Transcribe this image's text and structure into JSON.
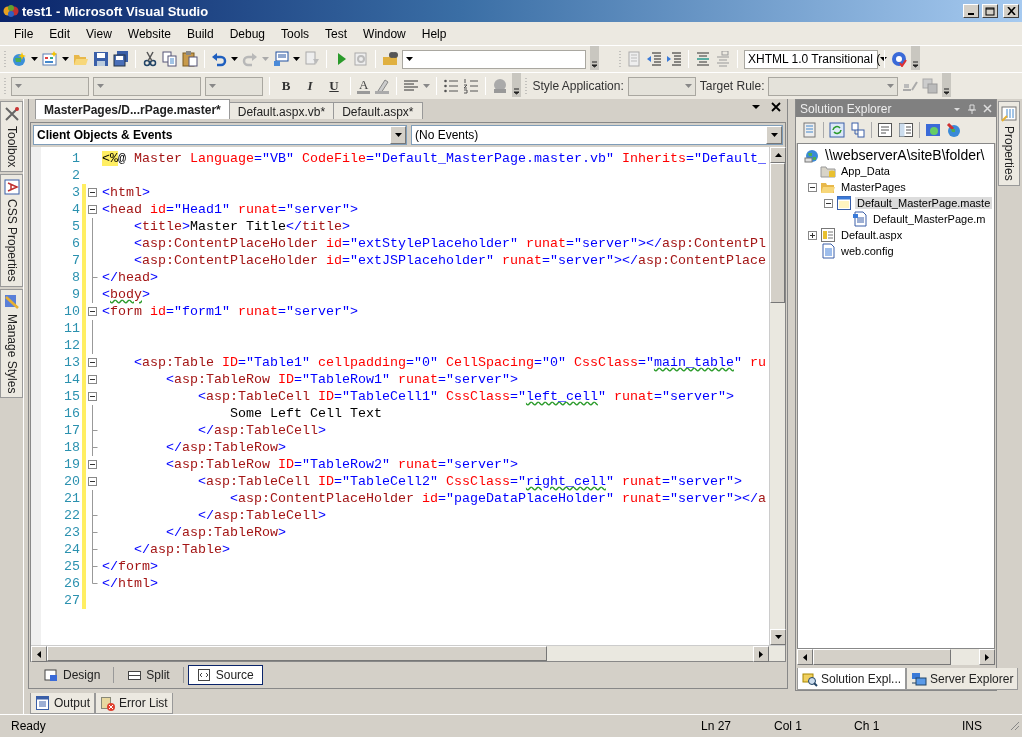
{
  "window": {
    "title": "test1 - Microsoft Visual Studio"
  },
  "menu": [
    "File",
    "Edit",
    "View",
    "Website",
    "Build",
    "Debug",
    "Tools",
    "Test",
    "Window",
    "Help"
  ],
  "toolbar_standard": {
    "doctype_combo": "XHTML 1.0 Transitional ("
  },
  "toolbar_formatting": {
    "format_buttons": [
      "B",
      "I",
      "U"
    ],
    "font_color": "A",
    "style_application_label": "Style Application:",
    "target_rule_label": "Target Rule:"
  },
  "left_dock_tabs": [
    {
      "label": "Toolbox",
      "kind": "toolbox"
    },
    {
      "label": "CSS Properties",
      "kind": "css"
    },
    {
      "label": "Manage Styles",
      "kind": "styles"
    }
  ],
  "document_tabs": [
    {
      "label": "MasterPages/D...rPage.master*",
      "selected": true
    },
    {
      "label": "Default.aspx.vb*",
      "selected": false
    },
    {
      "label": "Default.aspx*",
      "selected": false
    }
  ],
  "editor": {
    "object_dropdown": "Client Objects & Events",
    "event_dropdown": "(No Events)",
    "lines": [
      {
        "number": "1",
        "kind": "plain",
        "changed": false,
        "tokens": [
          {
            "kind": "mark",
            "text": "<%"
          },
          {
            "kind": "text",
            "text": "@ "
          },
          {
            "kind": "tag",
            "text": "Master"
          },
          {
            "kind": "attr",
            "text": " Language"
          },
          {
            "kind": "value",
            "text": "=\"VB\""
          },
          {
            "kind": "attr",
            "text": " CodeFile"
          },
          {
            "kind": "value",
            "text": "=\"Default_MasterPage.master.vb\""
          },
          {
            "kind": "attr",
            "text": " Inherits"
          },
          {
            "kind": "value",
            "text": "=\"Default_"
          }
        ]
      },
      {
        "number": "2",
        "kind": "plain",
        "changed": false
      },
      {
        "number": "3",
        "kind": "fold_start",
        "changed": true,
        "tokens": [
          {
            "kind": "delim",
            "text": "<"
          },
          {
            "kind": "tag",
            "text": "html"
          },
          {
            "kind": "delim",
            "text": ">"
          }
        ]
      },
      {
        "number": "4",
        "kind": "fold_start",
        "changed": true,
        "tokens": [
          {
            "kind": "delim",
            "text": "<"
          },
          {
            "kind": "tag",
            "text": "head"
          },
          {
            "kind": "attr",
            "text": " id"
          },
          {
            "kind": "value",
            "text": "=\"Head1\""
          },
          {
            "kind": "attr",
            "text": " runat"
          },
          {
            "kind": "value",
            "text": "=\"server\""
          },
          {
            "kind": "delim",
            "text": ">"
          }
        ]
      },
      {
        "number": "5",
        "kind": "fold_body",
        "changed": true,
        "tokens": [
          {
            "kind": "delim",
            "text": "    <"
          },
          {
            "kind": "tag",
            "text": "title"
          },
          {
            "kind": "delim",
            "text": ">"
          },
          {
            "kind": "text",
            "text": "Master Title"
          },
          {
            "kind": "delim",
            "text": "</"
          },
          {
            "kind": "tag",
            "text": "title"
          },
          {
            "kind": "delim",
            "text": ">"
          }
        ]
      },
      {
        "number": "6",
        "kind": "fold_body",
        "changed": true,
        "tokens": [
          {
            "kind": "delim",
            "text": "    <"
          },
          {
            "kind": "tag",
            "text": "asp:ContentPlaceHolder"
          },
          {
            "kind": "attr",
            "text": " id"
          },
          {
            "kind": "value",
            "text": "=\"extStylePlaceholder\""
          },
          {
            "kind": "attr",
            "text": " runat"
          },
          {
            "kind": "value",
            "text": "=\"server\""
          },
          {
            "kind": "delim",
            "text": "></"
          },
          {
            "kind": "tag",
            "text": "asp:ContentPl"
          }
        ]
      },
      {
        "number": "7",
        "kind": "fold_body",
        "changed": true,
        "tokens": [
          {
            "kind": "delim",
            "text": "    <"
          },
          {
            "kind": "tag",
            "text": "asp:ContentPlaceHolder"
          },
          {
            "kind": "attr",
            "text": " id"
          },
          {
            "kind": "value",
            "text": "=\"extJSPlaceholder\""
          },
          {
            "kind": "attr",
            "text": " runat"
          },
          {
            "kind": "value",
            "text": "=\"server\""
          },
          {
            "kind": "delim",
            "text": "></"
          },
          {
            "kind": "tag",
            "text": "asp:ContentPlace"
          }
        ]
      },
      {
        "number": "8",
        "kind": "fold_end",
        "changed": true,
        "tokens": [
          {
            "kind": "delim",
            "text": "</"
          },
          {
            "kind": "tag",
            "text": "head"
          },
          {
            "kind": "delim",
            "text": ">"
          }
        ]
      },
      {
        "number": "9",
        "kind": "fold_body",
        "changed": true,
        "tokens": [
          {
            "kind": "delim",
            "text": "<"
          },
          {
            "kind": "tag_wavy",
            "text": "body"
          },
          {
            "kind": "delim",
            "text": ">"
          }
        ]
      },
      {
        "number": "10",
        "kind": "fold_start",
        "changed": true,
        "tokens": [
          {
            "kind": "delim",
            "text": "<"
          },
          {
            "kind": "tag",
            "text": "form"
          },
          {
            "kind": "attr",
            "text": " id"
          },
          {
            "kind": "value",
            "text": "=\"form1\""
          },
          {
            "kind": "attr",
            "text": " runat"
          },
          {
            "kind": "value",
            "text": "=\"server\""
          },
          {
            "kind": "delim",
            "text": ">"
          }
        ]
      },
      {
        "number": "11",
        "kind": "fold_body",
        "changed": true
      },
      {
        "number": "12",
        "kind": "fold_body",
        "changed": true
      },
      {
        "number": "13",
        "kind": "fold_start",
        "changed": true,
        "tokens": [
          {
            "kind": "delim",
            "text": "    <"
          },
          {
            "kind": "tag",
            "text": "asp:Table"
          },
          {
            "kind": "attr",
            "text": " ID"
          },
          {
            "kind": "value",
            "text": "=\"Table1\""
          },
          {
            "kind": "attr",
            "text": " cellpadding"
          },
          {
            "kind": "value",
            "text": "=\"0\""
          },
          {
            "kind": "attr",
            "text": " CellSpacing"
          },
          {
            "kind": "value",
            "text": "=\"0\""
          },
          {
            "kind": "attr",
            "text": " CssClass"
          },
          {
            "kind": "value",
            "text": "=\""
          },
          {
            "kind": "value_wavy",
            "text": "main_table"
          },
          {
            "kind": "value",
            "text": "\""
          },
          {
            "kind": "attr",
            "text": " ru"
          }
        ]
      },
      {
        "number": "14",
        "kind": "fold_start",
        "changed": true,
        "tokens": [
          {
            "kind": "delim",
            "text": "        <"
          },
          {
            "kind": "tag",
            "text": "asp:TableRow"
          },
          {
            "kind": "attr",
            "text": " ID"
          },
          {
            "kind": "value",
            "text": "=\"TableRow1\""
          },
          {
            "kind": "attr",
            "text": " runat"
          },
          {
            "kind": "value",
            "text": "=\"server\""
          },
          {
            "kind": "delim",
            "text": ">"
          }
        ]
      },
      {
        "number": "15",
        "kind": "fold_start",
        "changed": true,
        "tokens": [
          {
            "kind": "delim",
            "text": "            <"
          },
          {
            "kind": "tag",
            "text": "asp:TableCell"
          },
          {
            "kind": "attr",
            "text": " ID"
          },
          {
            "kind": "value",
            "text": "=\"TableCell1\""
          },
          {
            "kind": "attr",
            "text": " CssClass"
          },
          {
            "kind": "value",
            "text": "=\""
          },
          {
            "kind": "value_wavy",
            "text": "left_cell"
          },
          {
            "kind": "value",
            "text": "\""
          },
          {
            "kind": "attr",
            "text": " runat"
          },
          {
            "kind": "value",
            "text": "=\"server\""
          },
          {
            "kind": "delim",
            "text": ">"
          }
        ]
      },
      {
        "number": "16",
        "kind": "fold_body",
        "changed": true,
        "tokens": [
          {
            "kind": "text",
            "text": "                Some Left Cell Text"
          }
        ]
      },
      {
        "number": "17",
        "kind": "fold_end",
        "changed": true,
        "tokens": [
          {
            "kind": "delim",
            "text": "            </"
          },
          {
            "kind": "tag",
            "text": "asp:TableCell"
          },
          {
            "kind": "delim",
            "text": ">"
          }
        ]
      },
      {
        "number": "18",
        "kind": "fold_end",
        "changed": true,
        "tokens": [
          {
            "kind": "delim",
            "text": "        </"
          },
          {
            "kind": "tag",
            "text": "asp:TableRow"
          },
          {
            "kind": "delim",
            "text": ">"
          }
        ]
      },
      {
        "number": "19",
        "kind": "fold_start",
        "changed": true,
        "tokens": [
          {
            "kind": "delim",
            "text": "        <"
          },
          {
            "kind": "tag",
            "text": "asp:TableRow"
          },
          {
            "kind": "attr",
            "text": " ID"
          },
          {
            "kind": "value",
            "text": "=\"TableRow2\""
          },
          {
            "kind": "attr",
            "text": " runat"
          },
          {
            "kind": "value",
            "text": "=\"server\""
          },
          {
            "kind": "delim",
            "text": ">"
          }
        ]
      },
      {
        "number": "20",
        "kind": "fold_start",
        "changed": true,
        "tokens": [
          {
            "kind": "delim",
            "text": "            <"
          },
          {
            "kind": "tag",
            "text": "asp:TableCell"
          },
          {
            "kind": "attr",
            "text": " ID"
          },
          {
            "kind": "value",
            "text": "=\"TableCell2\""
          },
          {
            "kind": "attr",
            "text": " CssClass"
          },
          {
            "kind": "value",
            "text": "=\""
          },
          {
            "kind": "value_wavy",
            "text": "right_cell"
          },
          {
            "kind": "value",
            "text": "\""
          },
          {
            "kind": "attr",
            "text": " runat"
          },
          {
            "kind": "value",
            "text": "=\"server\""
          },
          {
            "kind": "delim",
            "text": ">"
          }
        ]
      },
      {
        "number": "21",
        "kind": "fold_body",
        "changed": true,
        "tokens": [
          {
            "kind": "delim",
            "text": "                <"
          },
          {
            "kind": "tag",
            "text": "asp:ContentPlaceHolder"
          },
          {
            "kind": "attr",
            "text": " id"
          },
          {
            "kind": "value",
            "text": "=\"pageDataPlaceHolder\""
          },
          {
            "kind": "attr",
            "text": " runat"
          },
          {
            "kind": "value",
            "text": "=\"server\""
          },
          {
            "kind": "delim",
            "text": "></"
          },
          {
            "kind": "tag",
            "text": "a"
          }
        ]
      },
      {
        "number": "22",
        "kind": "fold_end",
        "changed": true,
        "tokens": [
          {
            "kind": "delim",
            "text": "            </"
          },
          {
            "kind": "tag",
            "text": "asp:TableCell"
          },
          {
            "kind": "delim",
            "text": ">"
          }
        ]
      },
      {
        "number": "23",
        "kind": "fold_end",
        "changed": true,
        "tokens": [
          {
            "kind": "delim",
            "text": "        </"
          },
          {
            "kind": "tag",
            "text": "asp:TableRow"
          },
          {
            "kind": "delim",
            "text": ">"
          }
        ]
      },
      {
        "number": "24",
        "kind": "fold_end",
        "changed": true,
        "tokens": [
          {
            "kind": "delim",
            "text": "    </"
          },
          {
            "kind": "tag",
            "text": "asp:Table"
          },
          {
            "kind": "delim",
            "text": ">"
          }
        ]
      },
      {
        "number": "25",
        "kind": "fold_end",
        "changed": true,
        "tokens": [
          {
            "kind": "delim",
            "text": "</"
          },
          {
            "kind": "tag",
            "text": "form"
          },
          {
            "kind": "delim",
            "text": ">"
          }
        ]
      },
      {
        "number": "26",
        "kind": "fold_last",
        "changed": true,
        "tokens": [
          {
            "kind": "delim",
            "text": "</"
          },
          {
            "kind": "tag",
            "text": "html"
          },
          {
            "kind": "delim",
            "text": ">"
          }
        ]
      },
      {
        "number": "27",
        "kind": "plain",
        "changed": true
      }
    ]
  },
  "view_tabs": [
    {
      "label": "Design",
      "kind": "design",
      "selected": false
    },
    {
      "label": "Split",
      "kind": "split",
      "selected": false
    },
    {
      "label": "Source",
      "kind": "source",
      "selected": true
    }
  ],
  "bottom_tabs": [
    {
      "label": "Output",
      "kind": "output"
    },
    {
      "label": "Error List",
      "kind": "errors"
    }
  ],
  "solution_explorer": {
    "title": "Solution Explorer",
    "tree": [
      {
        "label": "\\\\webserverA\\siteB\\folder\\",
        "kind": "web",
        "selected": false,
        "children": [
          {
            "label": "App_Data",
            "kind": "data_folder",
            "selected": false
          },
          {
            "label": "MasterPages",
            "kind": "folder",
            "selected": false,
            "expanded": true,
            "children": [
              {
                "label": "Default_MasterPage.maste",
                "kind": "master",
                "selected": true,
                "expanded": true,
                "children": [
                  {
                    "label": "Default_MasterPage.m",
                    "kind": "code",
                    "selected": false
                  }
                ]
              }
            ]
          },
          {
            "label": "Default.aspx",
            "kind": "page",
            "selected": false,
            "expanded": false
          },
          {
            "label": "web.config",
            "kind": "config",
            "selected": false
          }
        ]
      }
    ],
    "tabs": [
      {
        "label": "Solution Expl...",
        "kind": "solution",
        "selected": true
      },
      {
        "label": "Server Explorer",
        "kind": "server",
        "selected": false
      }
    ]
  },
  "right_dock_tabs": [
    {
      "label": "Properties"
    }
  ],
  "status_bar": {
    "message": "Ready",
    "line": "Ln 27",
    "column": "Col 1",
    "char": "Ch 1",
    "mode": "INS"
  }
}
